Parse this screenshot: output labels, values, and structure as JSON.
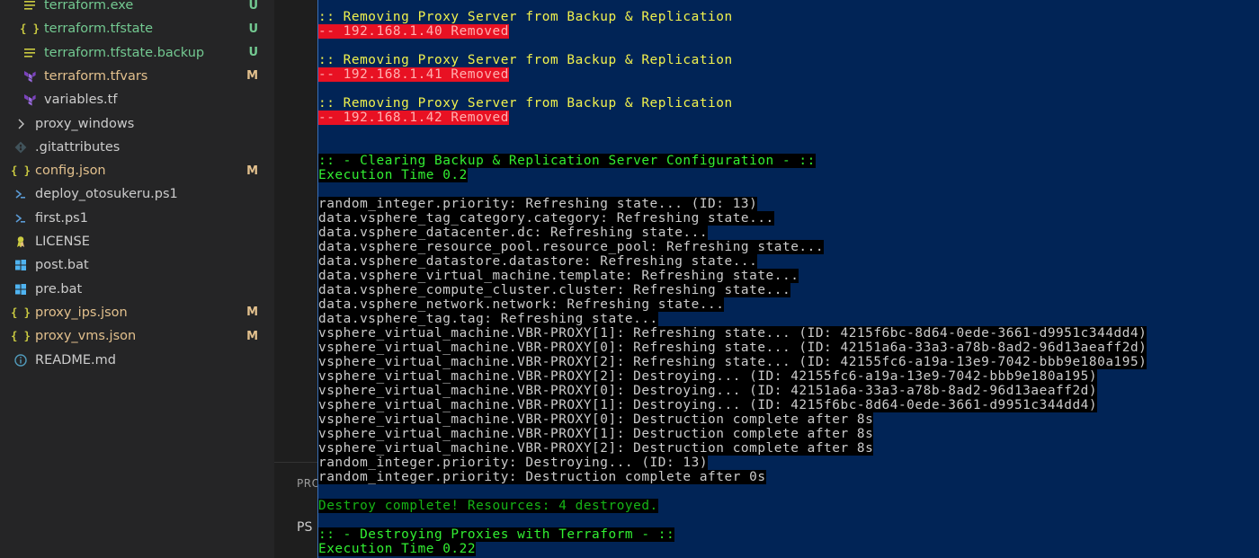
{
  "explorer": {
    "files": [
      {
        "name": "terraform.exe",
        "status": "U",
        "icon": "list-icon",
        "color": "untracked",
        "indent": 2
      },
      {
        "name": "terraform.tfstate",
        "status": "U",
        "icon": "json-icon",
        "color": "untracked",
        "indent": 2
      },
      {
        "name": "terraform.tfstate.backup",
        "status": "U",
        "icon": "list-icon",
        "color": "untracked",
        "indent": 2
      },
      {
        "name": "terraform.tfvars",
        "status": "M",
        "icon": "terraform-icon",
        "color": "modified",
        "indent": 2
      },
      {
        "name": "variables.tf",
        "status": "",
        "icon": "terraform-icon",
        "color": "normal",
        "indent": 2
      },
      {
        "name": "proxy_windows",
        "status": "",
        "icon": "chevron-right-icon",
        "color": "normal",
        "indent": 1
      },
      {
        "name": ".gitattributes",
        "status": "",
        "icon": "git-icon",
        "color": "normal",
        "indent": 1
      },
      {
        "name": "config.json",
        "status": "M",
        "icon": "json-icon",
        "color": "modified",
        "indent": 1
      },
      {
        "name": "deploy_otosukeru.ps1",
        "status": "",
        "icon": "powershell-icon",
        "color": "normal",
        "indent": 1
      },
      {
        "name": "first.ps1",
        "status": "",
        "icon": "powershell-icon",
        "color": "normal",
        "indent": 1
      },
      {
        "name": "LICENSE",
        "status": "",
        "icon": "license-icon",
        "color": "normal",
        "indent": 1
      },
      {
        "name": "post.bat",
        "status": "",
        "icon": "windows-icon",
        "color": "normal",
        "indent": 1
      },
      {
        "name": "pre.bat",
        "status": "",
        "icon": "windows-icon",
        "color": "normal",
        "indent": 1
      },
      {
        "name": "proxy_ips.json",
        "status": "M",
        "icon": "json-icon",
        "color": "modified",
        "indent": 1
      },
      {
        "name": "proxy_vms.json",
        "status": "M",
        "icon": "json-icon",
        "color": "modified",
        "indent": 1
      },
      {
        "name": "README.md",
        "status": "",
        "icon": "info-icon",
        "color": "normal",
        "indent": 1
      }
    ]
  },
  "panel": {
    "tab_label": "PRO",
    "shell_label": "PS"
  },
  "terminal": {
    "lines": [
      {
        "text": ":: Removing Proxy Server from Backup & Replication",
        "style": "yellow"
      },
      {
        "text": "-- 192.168.1.40 Removed",
        "style": "red"
      },
      {
        "text": "",
        "style": "blank"
      },
      {
        "text": ":: Removing Proxy Server from Backup & Replication",
        "style": "yellow"
      },
      {
        "text": "-- 192.168.1.41 Removed",
        "style": "red"
      },
      {
        "text": "",
        "style": "blank"
      },
      {
        "text": ":: Removing Proxy Server from Backup & Replication",
        "style": "yellow"
      },
      {
        "text": "-- 192.168.1.42 Removed",
        "style": "red"
      },
      {
        "text": "",
        "style": "blank"
      },
      {
        "text": "",
        "style": "blank"
      },
      {
        "text": ":: - Clearing Backup & Replication Server Configuration - ::",
        "style": "green"
      },
      {
        "text": "Execution Time 0.2",
        "style": "green"
      },
      {
        "text": "",
        "style": "blank"
      },
      {
        "text": "random_integer.priority: Refreshing state... (ID: 13)",
        "style": "gray"
      },
      {
        "text": "data.vsphere_tag_category.category: Refreshing state...",
        "style": "gray"
      },
      {
        "text": "data.vsphere_datacenter.dc: Refreshing state...",
        "style": "gray"
      },
      {
        "text": "data.vsphere_resource_pool.resource_pool: Refreshing state...",
        "style": "gray"
      },
      {
        "text": "data.vsphere_datastore.datastore: Refreshing state...",
        "style": "gray"
      },
      {
        "text": "data.vsphere_virtual_machine.template: Refreshing state...",
        "style": "gray"
      },
      {
        "text": "data.vsphere_compute_cluster.cluster: Refreshing state...",
        "style": "gray"
      },
      {
        "text": "data.vsphere_network.network: Refreshing state...",
        "style": "gray"
      },
      {
        "text": "data.vsphere_tag.tag: Refreshing state...",
        "style": "gray"
      },
      {
        "text": "vsphere_virtual_machine.VBR-PROXY[1]: Refreshing state... (ID: 4215f6bc-8d64-0ede-3661-d9951c344dd4)",
        "style": "gray"
      },
      {
        "text": "vsphere_virtual_machine.VBR-PROXY[0]: Refreshing state... (ID: 42151a6a-33a3-a78b-8ad2-96d13aeaff2d)",
        "style": "gray"
      },
      {
        "text": "vsphere_virtual_machine.VBR-PROXY[2]: Refreshing state... (ID: 42155fc6-a19a-13e9-7042-bbb9e180a195)",
        "style": "gray"
      },
      {
        "text": "vsphere_virtual_machine.VBR-PROXY[2]: Destroying... (ID: 42155fc6-a19a-13e9-7042-bbb9e180a195)",
        "style": "gray"
      },
      {
        "text": "vsphere_virtual_machine.VBR-PROXY[0]: Destroying... (ID: 42151a6a-33a3-a78b-8ad2-96d13aeaff2d)",
        "style": "gray"
      },
      {
        "text": "vsphere_virtual_machine.VBR-PROXY[1]: Destroying... (ID: 4215f6bc-8d64-0ede-3661-d9951c344dd4)",
        "style": "gray"
      },
      {
        "text": "vsphere_virtual_machine.VBR-PROXY[0]: Destruction complete after 8s",
        "style": "gray"
      },
      {
        "text": "vsphere_virtual_machine.VBR-PROXY[1]: Destruction complete after 8s",
        "style": "gray"
      },
      {
        "text": "vsphere_virtual_machine.VBR-PROXY[2]: Destruction complete after 8s",
        "style": "gray"
      },
      {
        "text": "random_integer.priority: Destroying... (ID: 13)",
        "style": "gray"
      },
      {
        "text": "random_integer.priority: Destruction complete after 0s",
        "style": "gray"
      },
      {
        "text": "",
        "style": "blank"
      },
      {
        "text": "Destroy complete! Resources: 4 destroyed.",
        "style": "darkgreen"
      },
      {
        "text": "",
        "style": "blank"
      },
      {
        "text": ":: - Destroying Proxies with Terraform - ::",
        "style": "green"
      },
      {
        "text": "Execution Time 0.22",
        "style": "green"
      }
    ]
  },
  "colors": {
    "sidebar_bg": "#252526",
    "terminal_bg": "#012456",
    "untracked": "#73c991",
    "modified": "#e2c08d",
    "json_icon": "#cbcb41",
    "terraform_icon": "#7b42bc",
    "windows_icon": "#4fb3f0"
  }
}
